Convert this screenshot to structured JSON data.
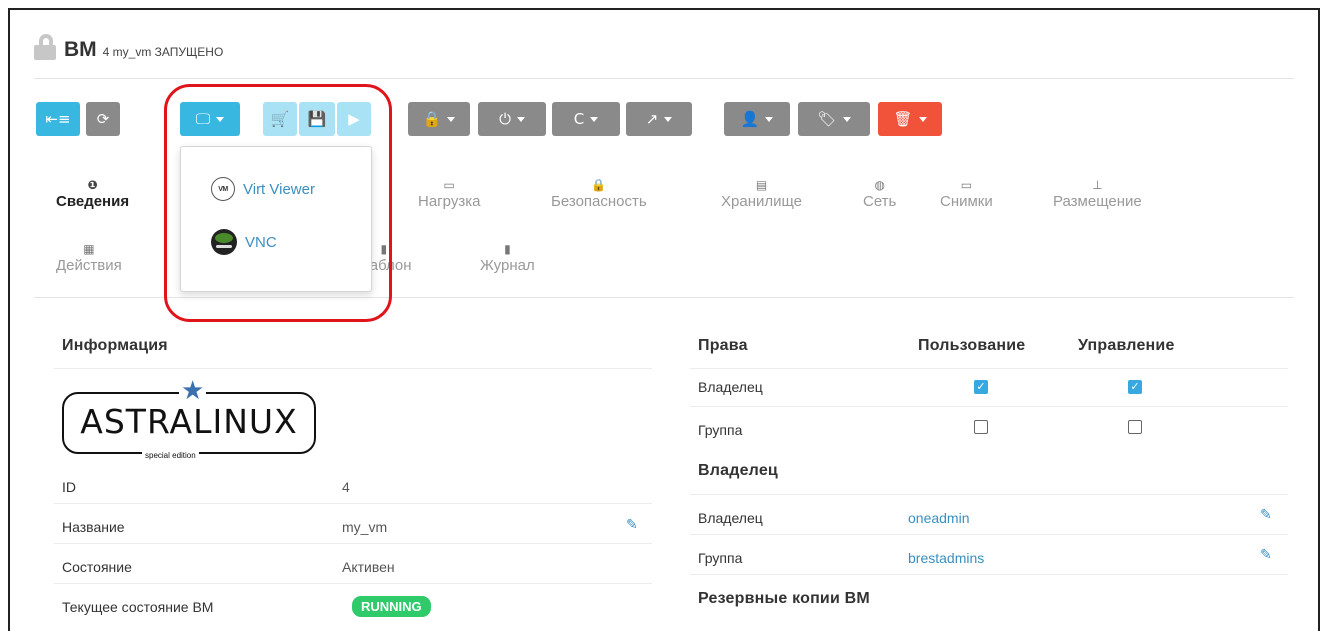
{
  "header": {
    "title": "ВМ",
    "subtitle": "4 my_vm ЗАПУЩЕНО"
  },
  "toolbar": {
    "buttons": [
      {
        "name": "back-to-list",
        "icon": "⇤≡"
      },
      {
        "name": "refresh",
        "icon": "⟳"
      },
      {
        "name": "console",
        "icon": "🖵"
      },
      {
        "name": "cart",
        "icon": "🛒"
      },
      {
        "name": "save",
        "icon": "💾"
      },
      {
        "name": "play",
        "icon": "▶"
      },
      {
        "name": "lock",
        "icon": "🔒"
      },
      {
        "name": "power",
        "icon": "⏻"
      },
      {
        "name": "reboot",
        "icon": "C"
      },
      {
        "name": "share",
        "icon": "↗"
      },
      {
        "name": "user",
        "icon": "👤"
      },
      {
        "name": "tag",
        "icon": "🏷"
      },
      {
        "name": "delete",
        "icon": "🗑"
      }
    ]
  },
  "console_menu": {
    "items": [
      {
        "label": "Virt Viewer",
        "icon": "vmw-icon",
        "icon_text": "VM"
      },
      {
        "label": "VNC",
        "icon": "vnc-icon"
      }
    ]
  },
  "tabs": [
    {
      "label": "Сведения",
      "icon": "info-icon",
      "glyph": "❶",
      "active": true
    },
    {
      "label": "Нагрузка",
      "icon": "monitor-icon",
      "glyph": "▭"
    },
    {
      "label": "Безопасность",
      "icon": "lock-icon",
      "glyph": "🔒"
    },
    {
      "label": "Хранилище",
      "icon": "storage-icon",
      "glyph": "▤"
    },
    {
      "label": "Сеть",
      "icon": "globe-icon",
      "glyph": "◍"
    },
    {
      "label": "Снимки",
      "icon": "laptop-icon",
      "glyph": "▭"
    },
    {
      "label": "Размещение",
      "icon": "sitemap-icon",
      "glyph": "⊥"
    },
    {
      "label": "Действия",
      "icon": "calendar-icon",
      "glyph": "▦"
    },
    {
      "label": "Шаблон",
      "icon": "file-icon",
      "glyph": "▮"
    },
    {
      "label": "Журнал",
      "icon": "file-icon",
      "glyph": "▮"
    }
  ],
  "info": {
    "title": "Информация",
    "logo_text": "ASTRALINUX",
    "logo_sub": "special edition",
    "rows": [
      {
        "label": "ID",
        "value": "4"
      },
      {
        "label": "Название",
        "value": "my_vm"
      },
      {
        "label": "Состояние",
        "value": "Активен"
      },
      {
        "label": "Текущее состояние ВМ",
        "value": "RUNNING"
      }
    ]
  },
  "permissions": {
    "title": "Права",
    "col_use": "Пользование",
    "col_manage": "Управление",
    "rows": [
      {
        "label": "Владелец",
        "use": true,
        "manage": true
      },
      {
        "label": "Группа",
        "use": false,
        "manage": false
      }
    ]
  },
  "ownership": {
    "title": "Владелец",
    "owner_label": "Владелец",
    "owner_value": "oneadmin",
    "group_label": "Группа",
    "group_value": "brestadmins"
  },
  "backups": {
    "title": "Резервные копии ВМ"
  },
  "colors": {
    "accent": "#38b7e1",
    "danger": "#f1523a",
    "button_gray": "#8a8a8a",
    "link": "#3a8fc2",
    "running": "#2fca6a",
    "highlight": "#e0151b"
  }
}
